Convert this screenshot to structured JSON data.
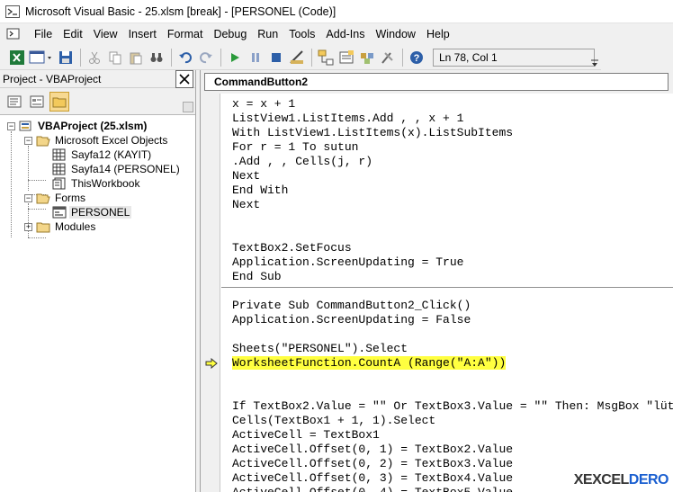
{
  "window": {
    "title": "Microsoft Visual Basic - 25.xlsm [break] - [PERSONEL (Code)]"
  },
  "menu": [
    "File",
    "Edit",
    "View",
    "Insert",
    "Format",
    "Debug",
    "Run",
    "Tools",
    "Add-Ins",
    "Window",
    "Help"
  ],
  "toolbar": {
    "status": "Ln 78, Col 1"
  },
  "project": {
    "title": "Project - VBAProject",
    "root": "VBAProject (25.xlsm)",
    "excel_objects": "Microsoft Excel Objects",
    "sheet1": "Sayfa12 (KAYIT)",
    "sheet2": "Sayfa14 (PERSONEL)",
    "workbook": "ThisWorkbook",
    "forms": "Forms",
    "form1": "PERSONEL",
    "modules": "Modules"
  },
  "code": {
    "object": "CommandButton2",
    "block1": [
      "x = x + 1",
      "ListView1.ListItems.Add , , x + 1",
      "With ListView1.ListItems(x).ListSubItems",
      "For r = 1 To sutun",
      ".Add , , Cells(j, r)",
      "Next",
      "End With",
      "Next",
      "",
      "",
      "TextBox2.SetFocus",
      "Application.ScreenUpdating = True",
      "End Sub"
    ],
    "block2": [
      "Private Sub CommandButton2_Click()",
      "Application.ScreenUpdating = False",
      "",
      "Sheets(\"PERSONEL\").Select"
    ],
    "highlighted": "WorksheetFunction.CountA (Range(\"A:A\"))",
    "block3": [
      "",
      "",
      "If TextBox2.Value = \"\" Or TextBox3.Value = \"\" Then: MsgBox \"lüt",
      "Cells(TextBox1 + 1, 1).Select",
      "ActiveCell = TextBox1",
      "ActiveCell.Offset(0, 1) = TextBox2.Value",
      "ActiveCell.Offset(0, 2) = TextBox3.Value",
      "ActiveCell.Offset(0, 3) = TextBox4.Value",
      "ActiveCell.Offset(0, 4) = TextBox5.Value"
    ]
  },
  "watermark": {
    "prefix": "X",
    "middle": "EXCEL",
    "suffix": "DERO"
  }
}
